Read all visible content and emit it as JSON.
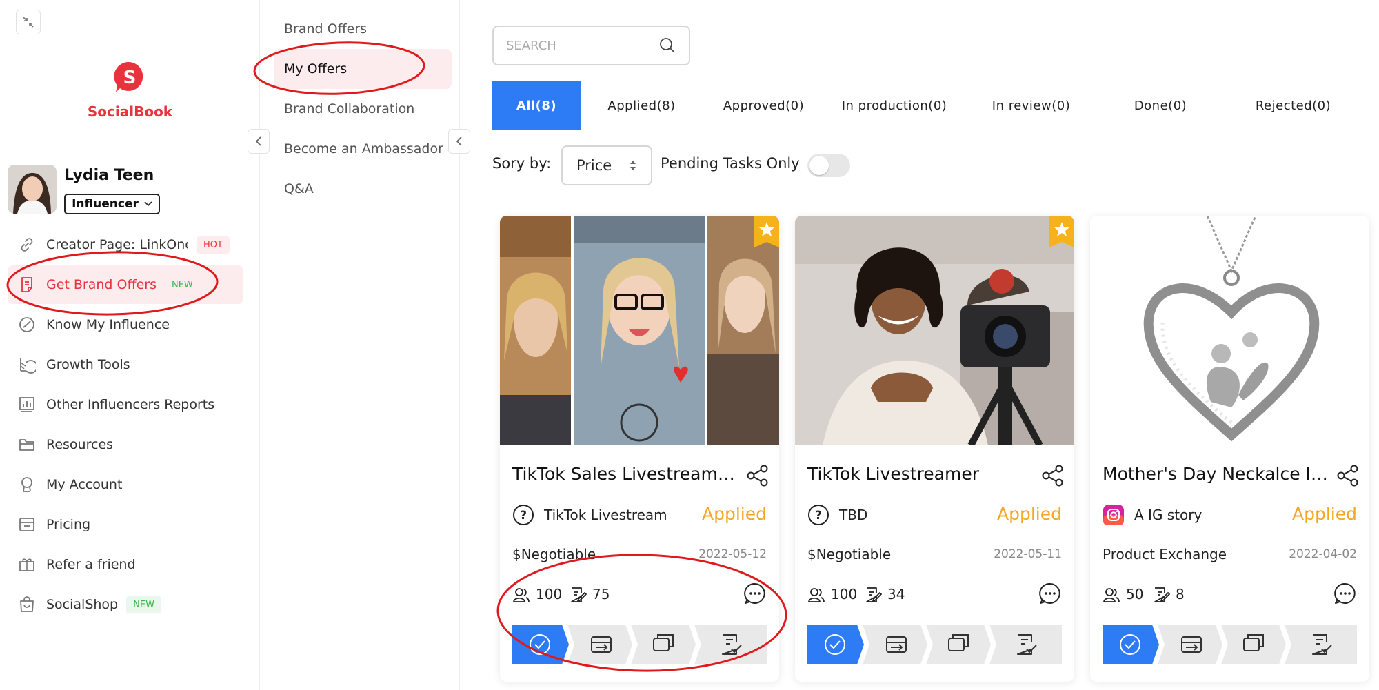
{
  "sidebar": {
    "logo_text": "SocialBook",
    "profile": {
      "name": "Lydia Teen",
      "role": "Influencer"
    },
    "items": [
      {
        "label": "Creator Page: LinkOne",
        "tag": "HOT",
        "icon": "link-icon"
      },
      {
        "label": "Get Brand Offers",
        "tag": "NEW",
        "icon": "document-icon"
      },
      {
        "label": "Know My Influence",
        "icon": "gauge-icon"
      },
      {
        "label": "Growth Tools",
        "icon": "chart-pie-icon"
      },
      {
        "label": "Other Influencers Reports",
        "icon": "report-icon"
      },
      {
        "label": "Resources",
        "icon": "folder-icon"
      },
      {
        "label": "My Account",
        "icon": "user-icon"
      },
      {
        "label": "Pricing",
        "icon": "tag-icon"
      },
      {
        "label": "Refer a friend",
        "icon": "gift-icon"
      },
      {
        "label": "SocialShop",
        "tag": "NEW",
        "icon": "shop-bag-icon"
      }
    ]
  },
  "subnav": {
    "items": [
      {
        "label": "Brand Offers"
      },
      {
        "label": "My Offers"
      },
      {
        "label": "Brand Collaboration"
      },
      {
        "label": "Become an Ambassador"
      },
      {
        "label": "Q&A"
      }
    ]
  },
  "search": {
    "placeholder": "SEARCH"
  },
  "tabs": [
    {
      "label": "All(8)"
    },
    {
      "label": "Applied(8)"
    },
    {
      "label": "Approved(0)"
    },
    {
      "label": "In production(0)"
    },
    {
      "label": "In review(0)"
    },
    {
      "label": "Done(0)"
    },
    {
      "label": "Rejected(0)"
    }
  ],
  "sort": {
    "label": "Sory by:",
    "value": "Price",
    "pending_label": "Pending Tasks Only"
  },
  "offers": [
    {
      "title": "TikTok Sales Livestreamer …",
      "platform": "TikTok Livestream",
      "platform_icon": "question-icon",
      "status": "Applied",
      "price": "$Negotiable",
      "date": "2022-05-12",
      "followers": "100",
      "posts": "75"
    },
    {
      "title": "TikTok Livestreamer",
      "platform": "TBD",
      "platform_icon": "question-icon",
      "status": "Applied",
      "price": "$Negotiable",
      "date": "2022-05-11",
      "followers": "100",
      "posts": "34"
    },
    {
      "title": "Mother's Day Neckalce Infl…",
      "platform": "A IG story",
      "platform_icon": "instagram-icon",
      "status": "Applied",
      "price": "Product Exchange",
      "date": "2022-04-02",
      "followers": "50",
      "posts": "8"
    }
  ],
  "colors": {
    "brand": "#e8323c",
    "accent": "#2d7cf6",
    "status": "#f6a623",
    "annotation": "#e0191c"
  }
}
